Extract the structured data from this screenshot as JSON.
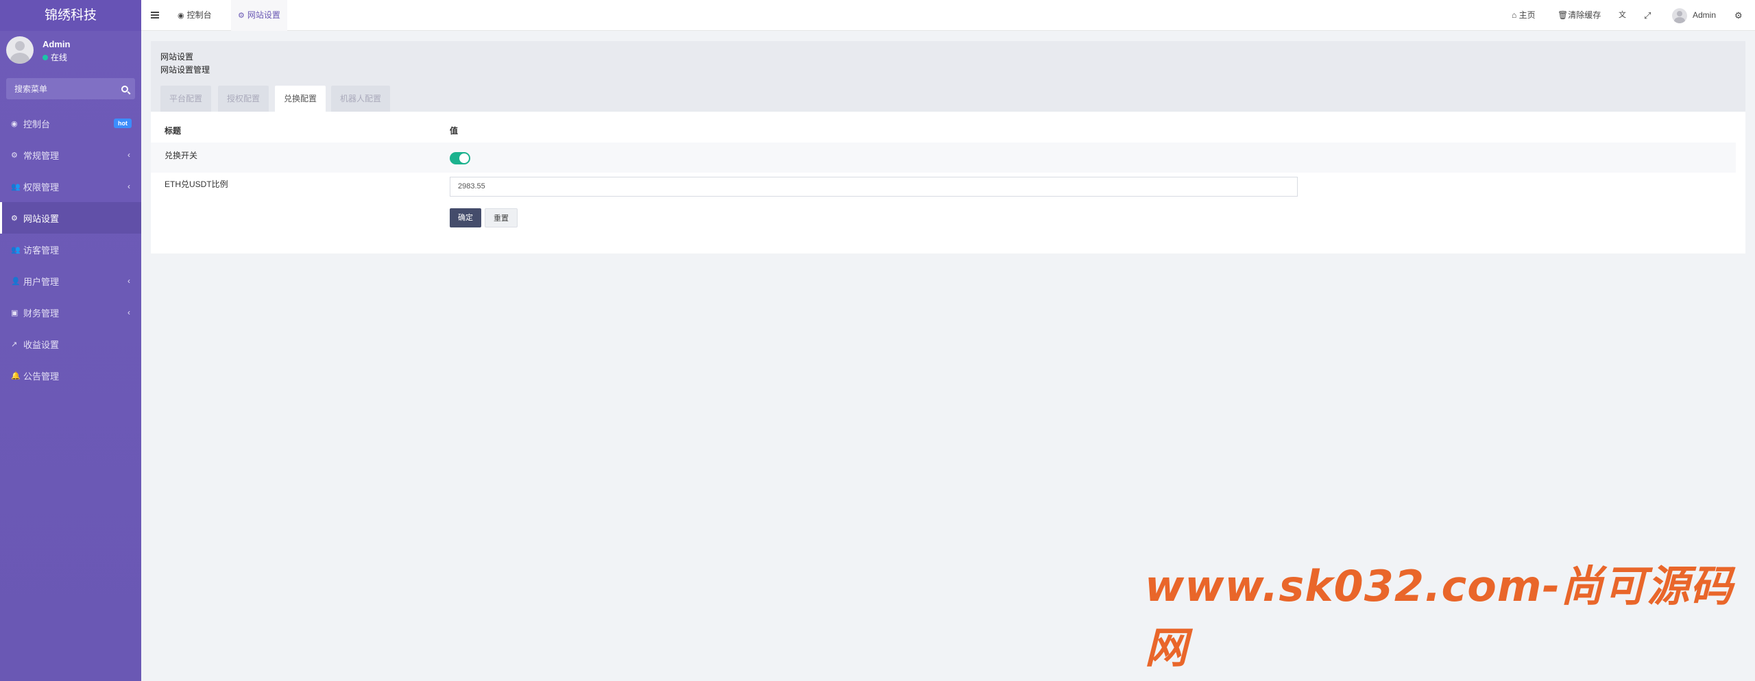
{
  "sidebar": {
    "logo": "锦绣科技",
    "user": {
      "name": "Admin",
      "status": "在线"
    },
    "search_placeholder": "搜索菜单",
    "items": [
      {
        "label": "控制台",
        "icon": "dashboard-icon",
        "glyph": "◉",
        "badge": "hot"
      },
      {
        "label": "常规管理",
        "icon": "cogs-icon",
        "glyph": "⚙",
        "arrow": "‹"
      },
      {
        "label": "权限管理",
        "icon": "group-icon",
        "glyph": "👥",
        "arrow": "‹"
      },
      {
        "label": "网站设置",
        "icon": "cogs-icon",
        "glyph": "⚙",
        "active": true
      },
      {
        "label": "访客管理",
        "icon": "group-icon",
        "glyph": "👥"
      },
      {
        "label": "用户管理",
        "icon": "user-icon",
        "glyph": "👤",
        "arrow": "‹"
      },
      {
        "label": "财务管理",
        "icon": "money-icon",
        "glyph": "▣",
        "arrow": "‹"
      },
      {
        "label": "收益设置",
        "icon": "chart-icon",
        "glyph": "↗"
      },
      {
        "label": "公告管理",
        "icon": "bell-icon",
        "glyph": "🔔"
      }
    ]
  },
  "topbar": {
    "tabs": [
      {
        "label": "控制台",
        "icon": "dashboard-icon"
      },
      {
        "label": "网站设置",
        "icon": "cogs-icon",
        "active": true
      }
    ],
    "right": {
      "home": "主页",
      "clear_cache": "清除缓存",
      "user": "Admin"
    }
  },
  "panel": {
    "title": "网站设置",
    "subtitle": "网站设置管理",
    "tabs": [
      "平台配置",
      "授权配置",
      "兑换配置",
      "机器人配置"
    ],
    "active_tab": 2,
    "headers": {
      "title": "标题",
      "value": "值"
    },
    "rows": [
      {
        "label": "兑换开关",
        "toggle_on": true
      },
      {
        "label": "ETH兑USDT比例",
        "value": "2983.55"
      }
    ],
    "buttons": {
      "confirm": "确定",
      "reset": "重置"
    }
  },
  "watermark": "www.sk032.com-尚可源码网",
  "colors": {
    "sidebar": "#6e5bb8",
    "toggle": "#1bb28e",
    "primary_button": "#444c6b",
    "watermark": "#e9662a"
  }
}
